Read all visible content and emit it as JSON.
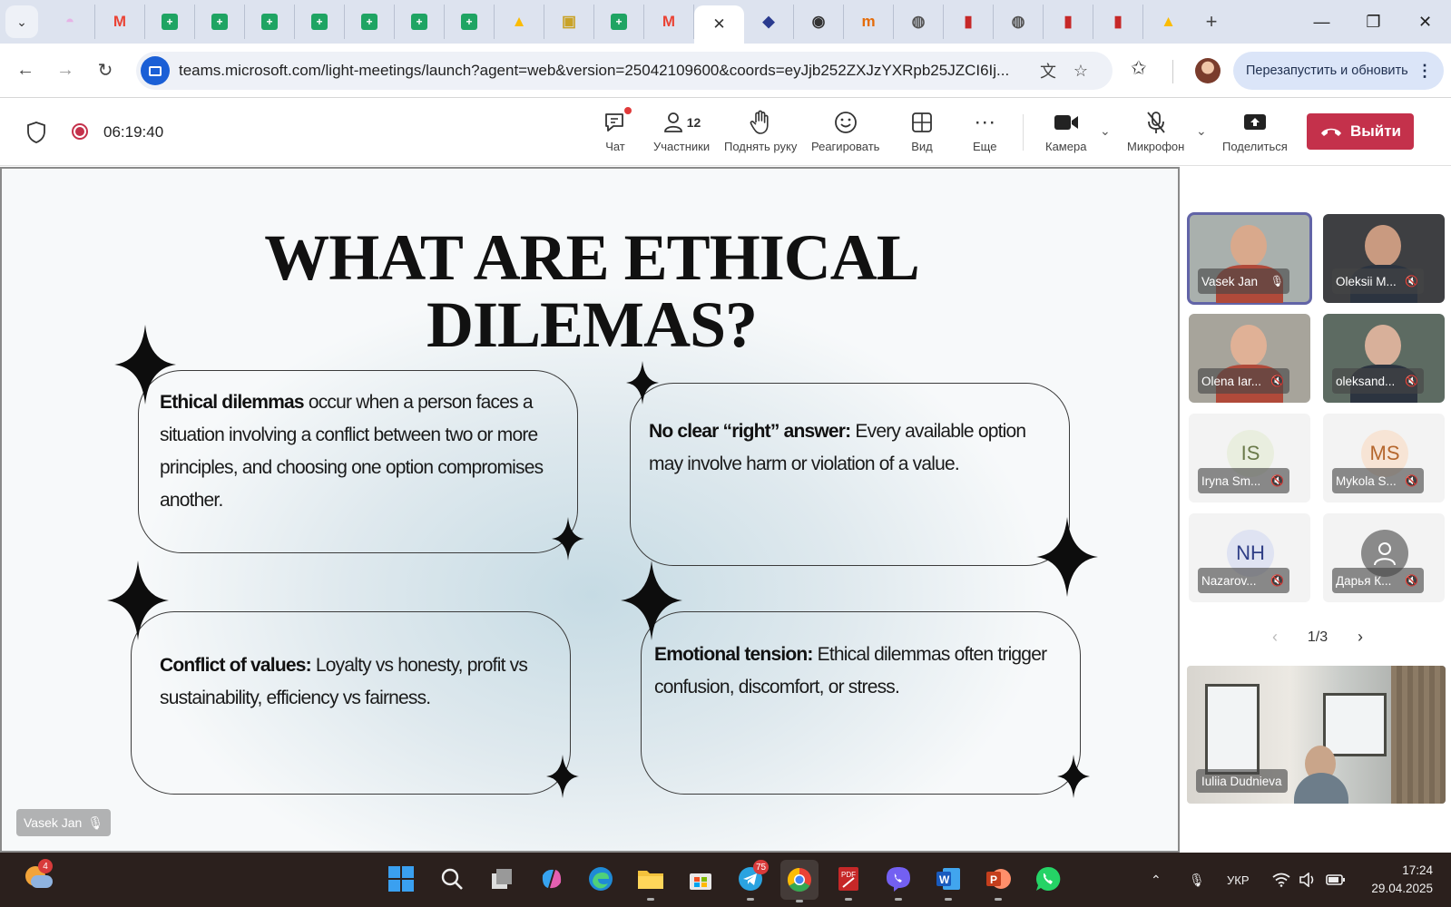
{
  "browser": {
    "tabs": [
      {
        "icon": "copilot-icon",
        "color": "#e6b3e6"
      },
      {
        "icon": "gmail-icon",
        "color": "#ea4335"
      },
      {
        "icon": "sheets-icon",
        "color": "#1fa463"
      },
      {
        "icon": "sheets-icon",
        "color": "#1fa463"
      },
      {
        "icon": "sheets-icon",
        "color": "#1fa463"
      },
      {
        "icon": "sheets-icon",
        "color": "#1fa463"
      },
      {
        "icon": "sheets-icon",
        "color": "#1fa463"
      },
      {
        "icon": "sheets-icon",
        "color": "#1fa463"
      },
      {
        "icon": "sheets-icon",
        "color": "#1fa463"
      },
      {
        "icon": "drive-icon",
        "color": "#fbbc04"
      },
      {
        "icon": "briefcase-icon",
        "color": "#c9a227"
      },
      {
        "icon": "sheets-icon",
        "color": "#1fa463"
      },
      {
        "icon": "gmail-icon",
        "color": "#ea4335"
      },
      {
        "icon": "close-icon",
        "color": "#333333",
        "active": true
      },
      {
        "icon": "shield-app-icon",
        "color": "#2a3b8f"
      },
      {
        "icon": "circle-app-icon",
        "color": "#333333"
      },
      {
        "icon": "m-app-icon",
        "color": "#e46c0a"
      },
      {
        "icon": "globe-icon",
        "color": "#555555"
      },
      {
        "icon": "book-icon",
        "color": "#c62828"
      },
      {
        "icon": "globe-icon",
        "color": "#555555"
      },
      {
        "icon": "book-icon",
        "color": "#c62828"
      },
      {
        "icon": "book-icon",
        "color": "#c62828"
      },
      {
        "icon": "drive-icon",
        "color": "#fbbc04"
      }
    ],
    "new_tab": "+",
    "url": "teams.microsoft.com/light-meetings/launch?agent=web&version=25042109600&coords=eyJjb252ZXJzYXRpb25JZCI6Ij...",
    "relaunch_label": "Перезапустить и обновить"
  },
  "meeting": {
    "timer": "06:19:40",
    "toolbar": {
      "chat": "Чат",
      "participants": "Участники",
      "participants_count": "12",
      "raise_hand": "Поднять руку",
      "react": "Реагировать",
      "view": "Вид",
      "more": "Еще",
      "camera": "Камера",
      "mic": "Микрофон",
      "share": "Поделиться",
      "leave": "Выйти"
    },
    "slide": {
      "title_line1": "WHAT ARE ETHICAL",
      "title_line2": "DILEMAS?",
      "cards": [
        {
          "bold": "Ethical dilemmas",
          "text": " occur when a person faces a situation involving a conflict between two or more principles, and choosing one option compromises another."
        },
        {
          "bold": "No clear “right” answer:",
          "text": " Every available option may involve harm or violation of a value."
        },
        {
          "bold": "Conflict of values:",
          "text": " Loyalty vs honesty, profit vs sustainability, efficiency vs fairness."
        },
        {
          "bold": "Emotional tension:",
          "text": " Ethical dilemmas often trigger confusion, discomfort, or stress."
        }
      ]
    },
    "presenter": "Vasek Jan",
    "participants": [
      {
        "name": "Vasek Jan",
        "type": "video",
        "active": true
      },
      {
        "name": "Oleksii M...",
        "type": "video"
      },
      {
        "name": "Olena Iar...",
        "type": "video"
      },
      {
        "name": "oleksand...",
        "type": "video"
      },
      {
        "name": "Iryna Sm...",
        "type": "initials",
        "initials": "IS",
        "bg": "#e9eedf",
        "fg": "#6a7a4a"
      },
      {
        "name": "Mykola S...",
        "type": "initials",
        "initials": "MS",
        "bg": "#f7e4d5",
        "fg": "#b5672e"
      },
      {
        "name": "Nazarov...",
        "type": "initials",
        "initials": "NH",
        "bg": "#dfe3f2",
        "fg": "#2f3e86"
      },
      {
        "name": "Дарья К...",
        "type": "avatar"
      }
    ],
    "page": "1/3",
    "self_view_name": "Iuliia Dudnieva"
  },
  "taskbar": {
    "weather_badge": "4",
    "telegram_badge": "75",
    "language": "УКР",
    "time": "17:24",
    "date": "29.04.2025"
  }
}
